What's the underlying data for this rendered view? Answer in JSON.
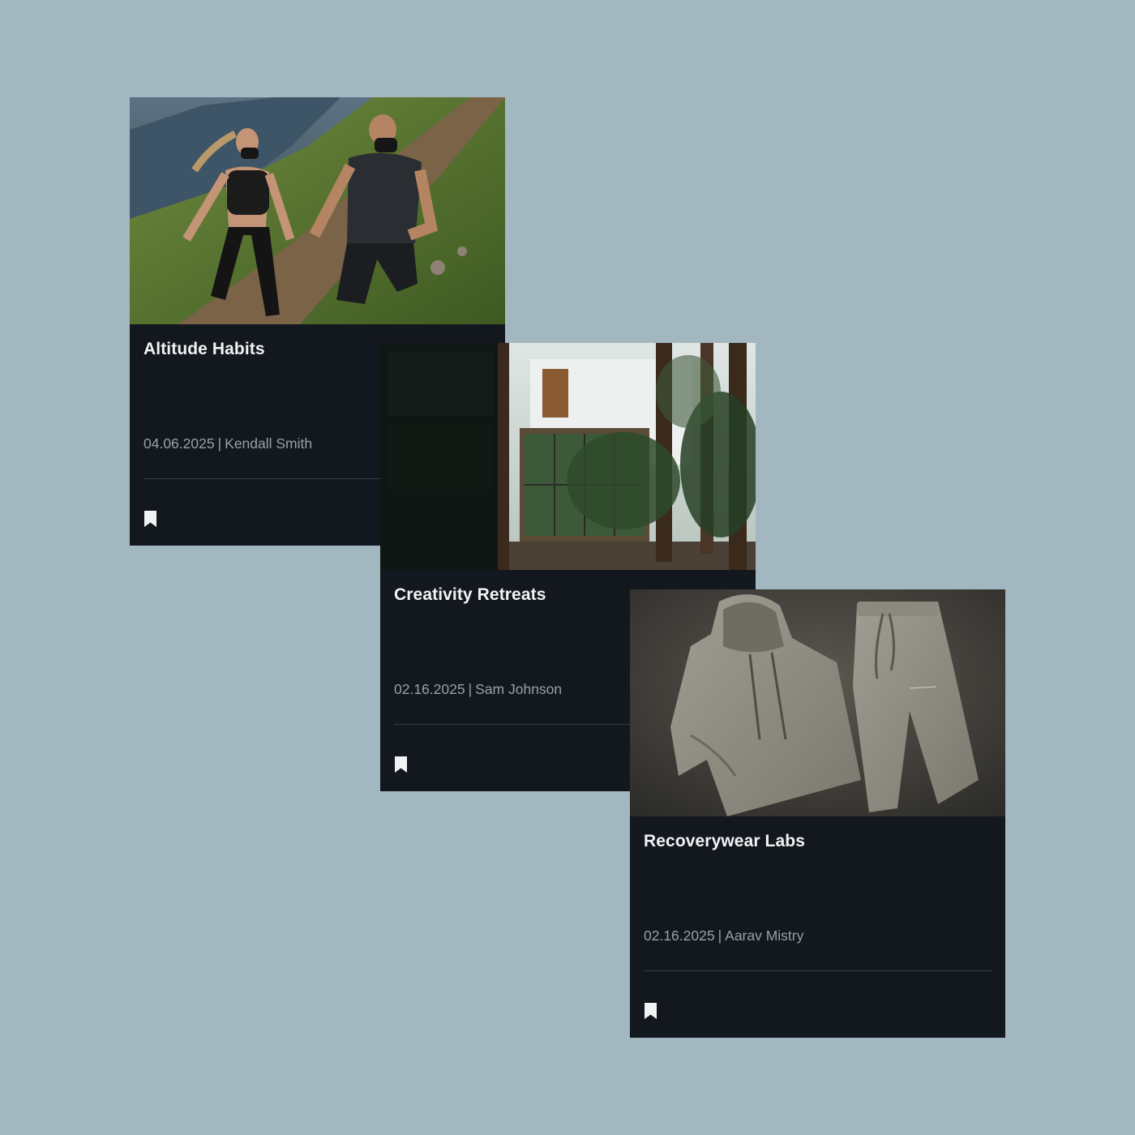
{
  "colors": {
    "page_background": "#a2b7c0",
    "card_background": "#13171e",
    "title_text": "#f1f2f4",
    "meta_text": "#9aa0a8",
    "divider": "#3a3f47",
    "icon": "#f1f2f4"
  },
  "cards": [
    {
      "title": "Altitude Habits",
      "date": "04.06.2025",
      "separator": "|",
      "author": "Kendall Smith",
      "image_icon": "trail-runners-photo",
      "action_icon": "bookmark-icon"
    },
    {
      "title": "Creativity Retreats",
      "date": "02.16.2025",
      "separator": "|",
      "author": "Sam Johnson",
      "image_icon": "forest-house-photo",
      "action_icon": "bookmark-icon"
    },
    {
      "title": "Recoverywear Labs",
      "date": "02.16.2025",
      "separator": "|",
      "author": "Aarav Mistry",
      "image_icon": "apparel-photo",
      "action_icon": "bookmark-icon"
    }
  ]
}
